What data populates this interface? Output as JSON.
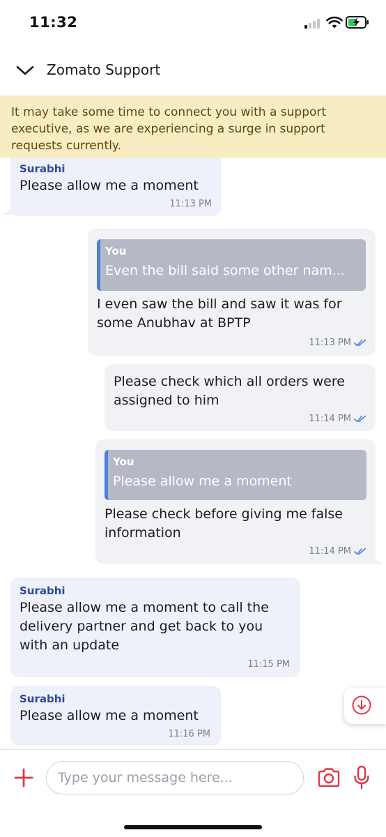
{
  "status_bar": {
    "time": "11:32"
  },
  "header": {
    "title": "Zomato Support"
  },
  "banner": {
    "text": "It may take some time to connect you with a support executive, as we are experiencing a surge in support requests currently."
  },
  "messages": [
    {
      "direction": "in",
      "sender": "Surabhi",
      "lines": [
        "Please allow me a moment"
      ],
      "time": "11:13 PM"
    },
    {
      "direction": "out",
      "quote": {
        "sender": "You",
        "text": "Even the bill said some other nam..."
      },
      "lines": [
        "I even saw the bill and saw it was for",
        "some Anubhav at BPTP"
      ],
      "time": "11:13 PM",
      "status": "read"
    },
    {
      "direction": "out",
      "lines": [
        "Please check which all orders were",
        "assigned to him"
      ],
      "time": "11:14 PM",
      "status": "read"
    },
    {
      "direction": "out",
      "quote": {
        "sender": "You",
        "text": "Please allow me a moment"
      },
      "lines": [
        "Please check before giving me false",
        "information"
      ],
      "time": "11:14 PM",
      "status": "read"
    },
    {
      "direction": "in",
      "sender": "Surabhi",
      "lines": [
        "Please allow me a moment to call the",
        "delivery partner and get back to you",
        "with an update"
      ],
      "time": "11:15 PM"
    },
    {
      "direction": "in",
      "sender": "Surabhi",
      "lines": [
        "Please allow me a moment"
      ],
      "time": "11:16 PM"
    }
  ],
  "composer": {
    "placeholder": "Type your message here...",
    "value": ""
  },
  "icons": {
    "back": "chevron-down-icon",
    "attach": "plus-icon",
    "camera": "camera-icon",
    "mic": "microphone-icon",
    "scroll": "arrow-down-circle-icon",
    "read_receipt": "double-check-icon"
  },
  "colors": {
    "accent": "#e23744",
    "sender_name": "#2b4a9a",
    "banner_bg": "#f8ecc3",
    "banner_text": "#5e4613",
    "incoming_bubble": "#eef1fa",
    "outgoing_bubble": "#f1f2f5",
    "quote_bg": "#b5b9c5",
    "quote_bar": "#4a7fdc",
    "read_tick": "#4a7fdc"
  }
}
